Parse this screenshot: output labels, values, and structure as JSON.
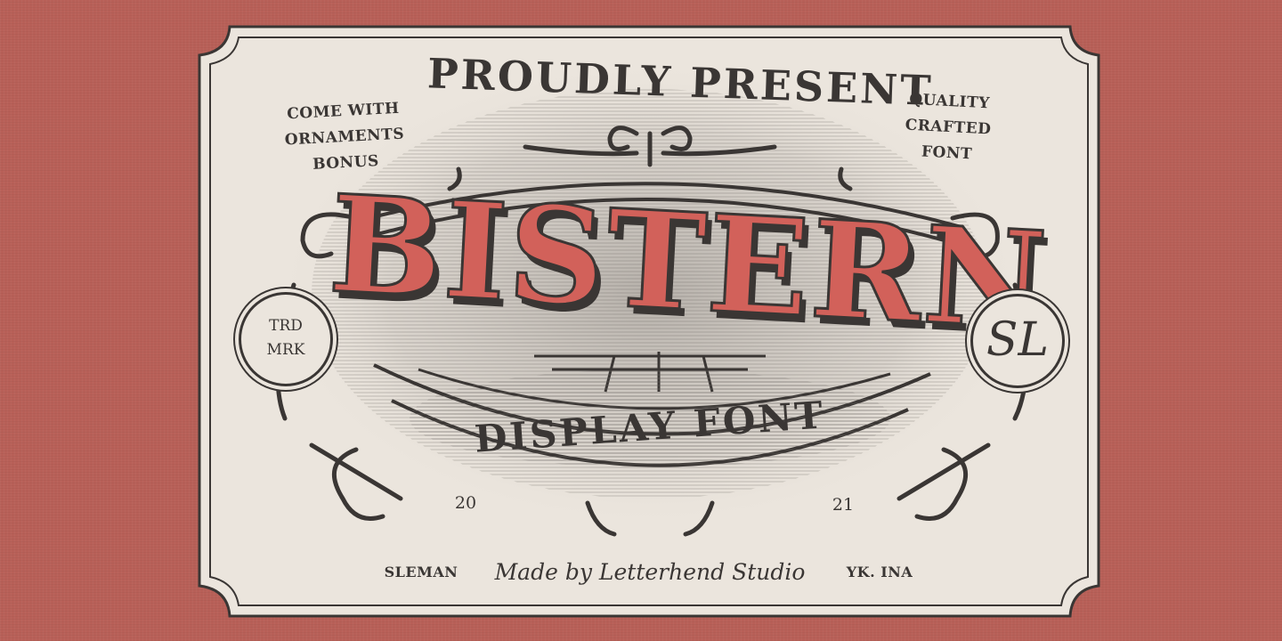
{
  "poster": {
    "headline": "PROUDLY PRESENT",
    "notes_left": [
      "COME WITH",
      "ORNAMENTS",
      "BONUS"
    ],
    "notes_right": [
      "QUALITY",
      "CRAFTED",
      "FONT"
    ],
    "main_title": "BISTERN",
    "subtitle": "DISPLAY FONT",
    "badge_left": [
      "TRD",
      "MRK"
    ],
    "badge_right": "SL",
    "year_left": "20",
    "year_right": "21",
    "footer_left": "SLEMAN",
    "signature": "Made by Letterhend Studio",
    "footer_right": "YK. INA"
  },
  "colors": {
    "background": "#b86058",
    "card": "#ebe5dd",
    "ink": "#3a3634",
    "accent": "#d2615a"
  }
}
